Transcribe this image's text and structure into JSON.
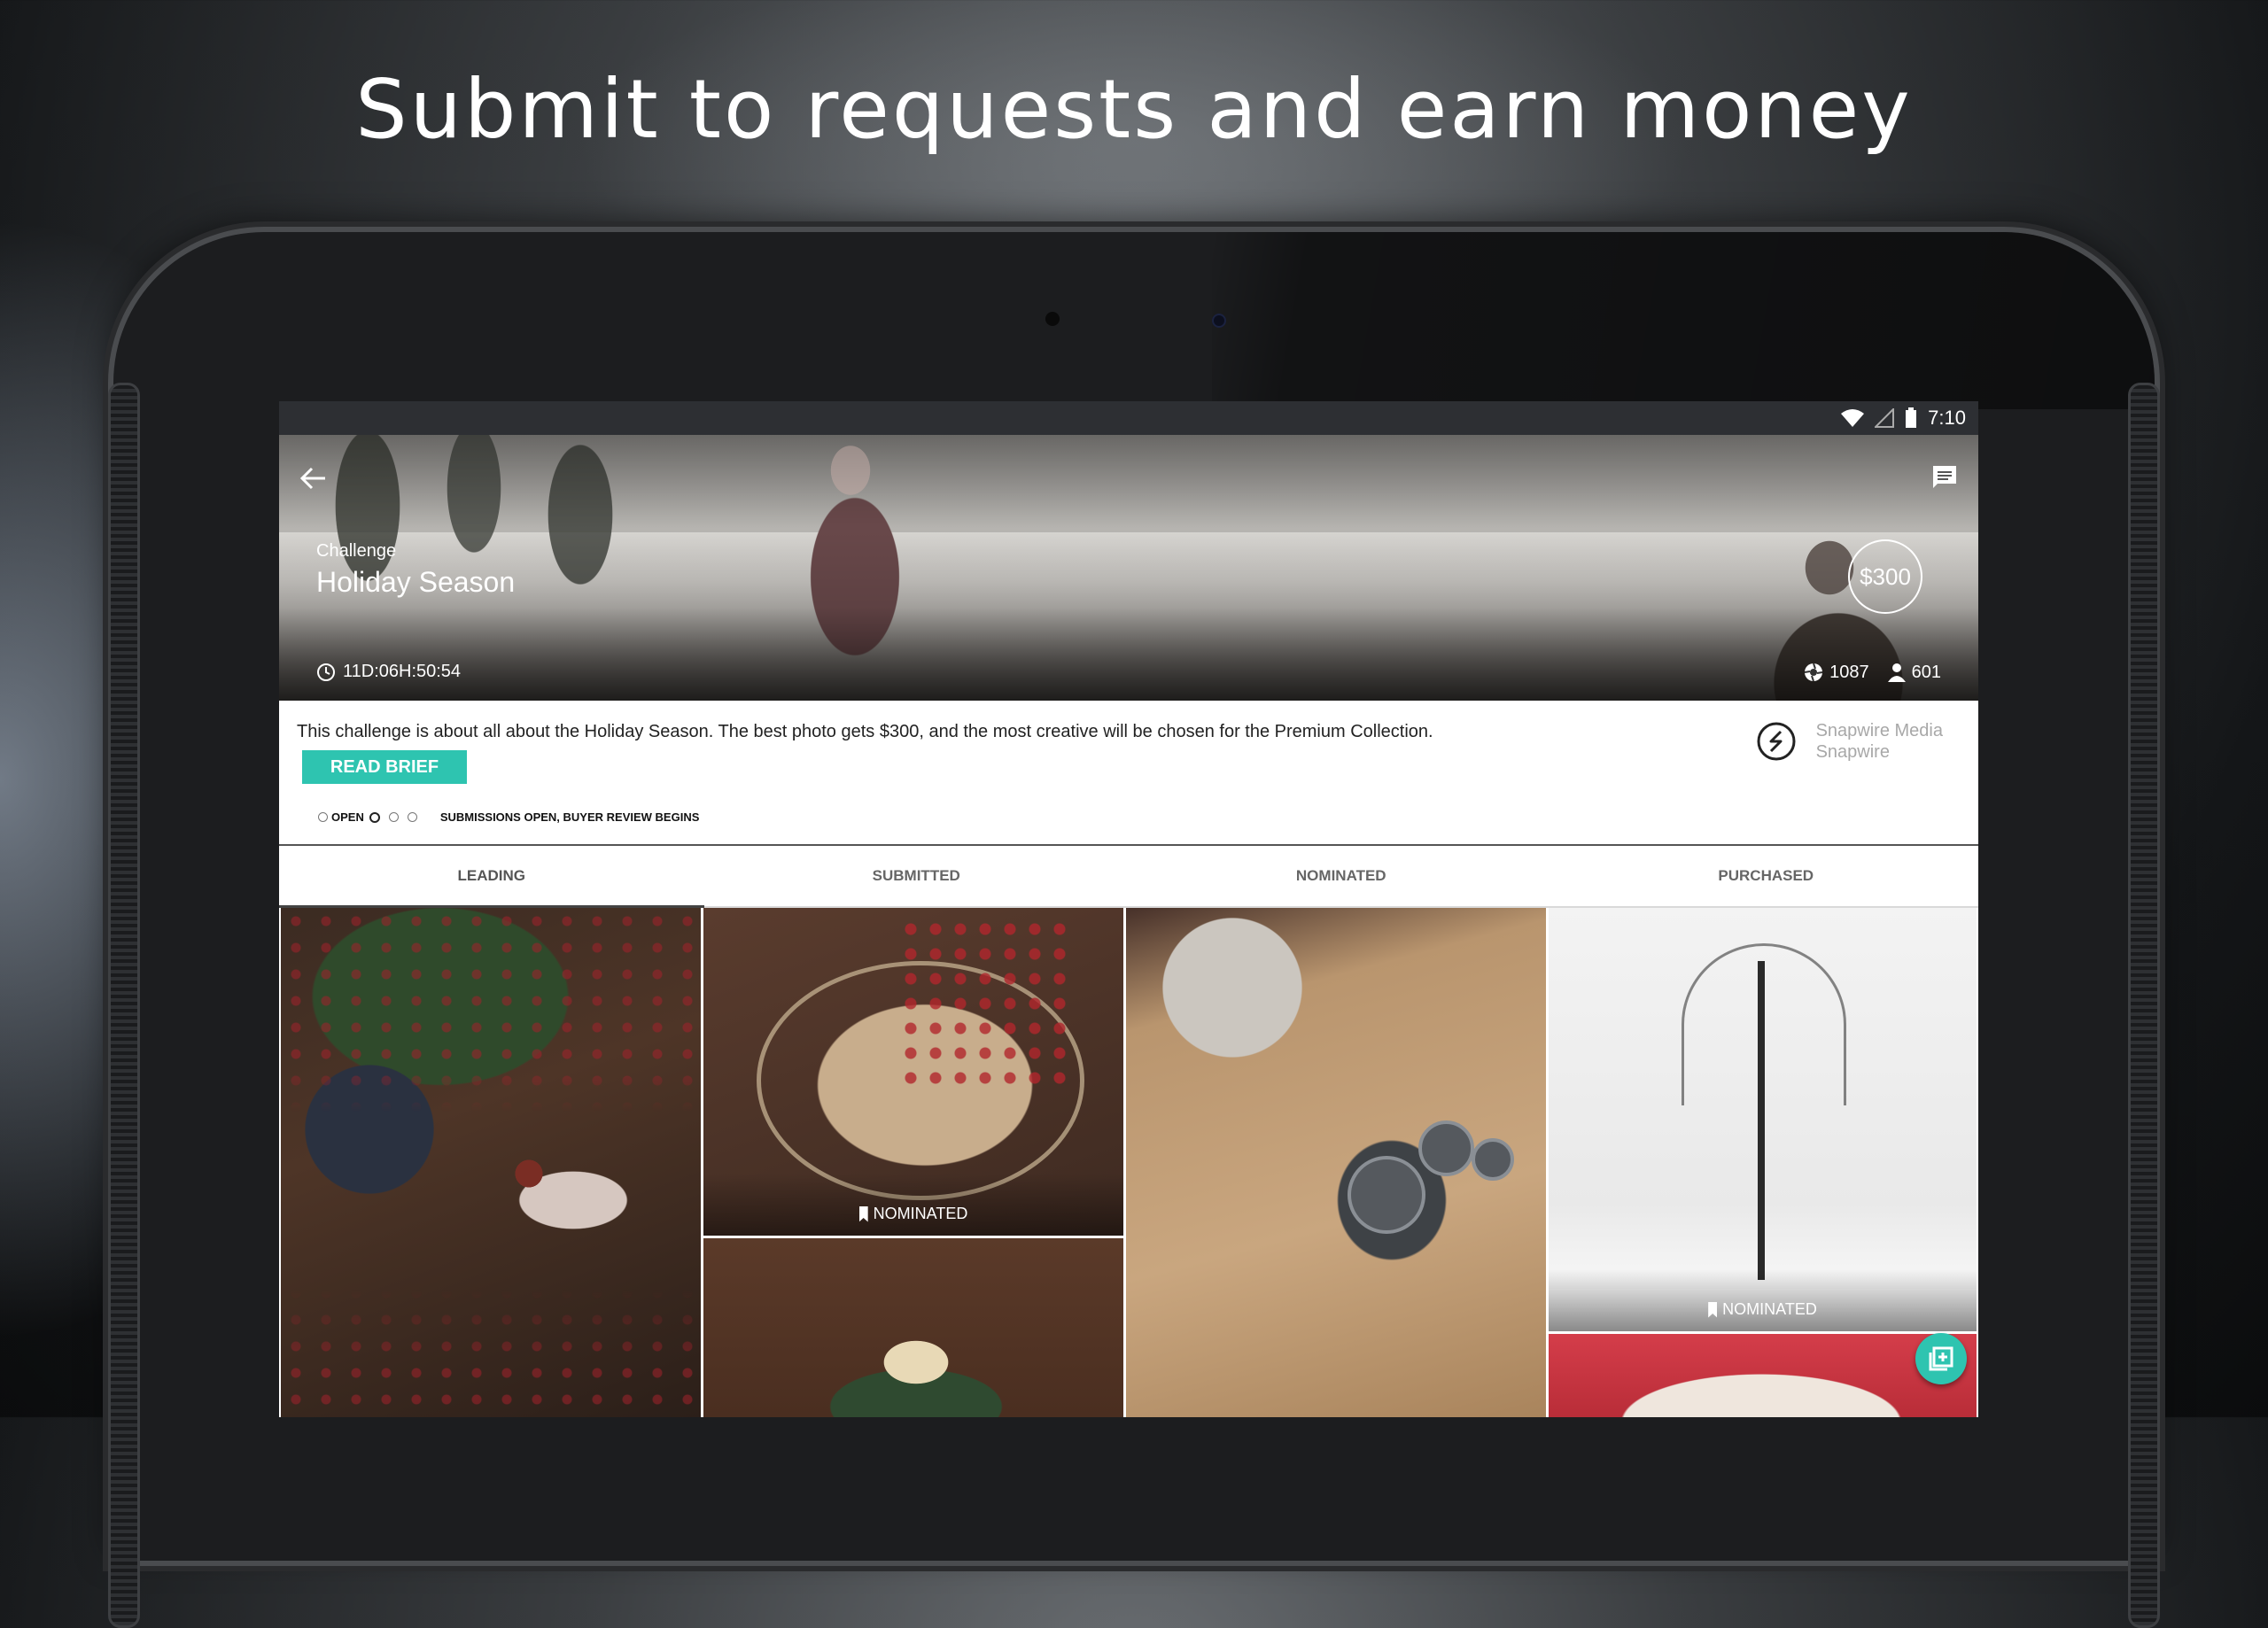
{
  "headline": "Submit to requests and earn money",
  "status_bar": {
    "time": "7:10"
  },
  "challenge": {
    "label": "Challenge",
    "title": "Holiday Season",
    "prize": "$300",
    "timer": "11D:06H:50:54",
    "photos_count": "1087",
    "participants_count": "601"
  },
  "info": {
    "description": "This challenge is about all about the Holiday Season. The best photo gets $300, and the most creative will be chosen for the Premium Collection.",
    "read_brief_label": "READ BRIEF",
    "phase_label": "OPEN",
    "phase_description": "SUBMISSIONS OPEN, BUYER REVIEW BEGINS",
    "sponsor_name": "Snapwire Media",
    "sponsor_sub": "Snapwire"
  },
  "tabs": [
    {
      "label": "LEADING",
      "active": true
    },
    {
      "label": "SUBMITTED",
      "active": false
    },
    {
      "label": "NOMINATED",
      "active": false
    },
    {
      "label": "PURCHASED",
      "active": false
    }
  ],
  "badges": {
    "nominated": "NOMINATED"
  },
  "colors": {
    "accent": "#2ec4b0",
    "status_bar": "#2d2f33"
  },
  "icons": [
    "back-arrow-icon",
    "chat-icon",
    "wifi-icon",
    "signal-icon",
    "battery-icon",
    "clock-icon",
    "aperture-icon",
    "person-icon",
    "snapwire-logo-icon",
    "bookmark-icon",
    "add-photo-icon"
  ]
}
